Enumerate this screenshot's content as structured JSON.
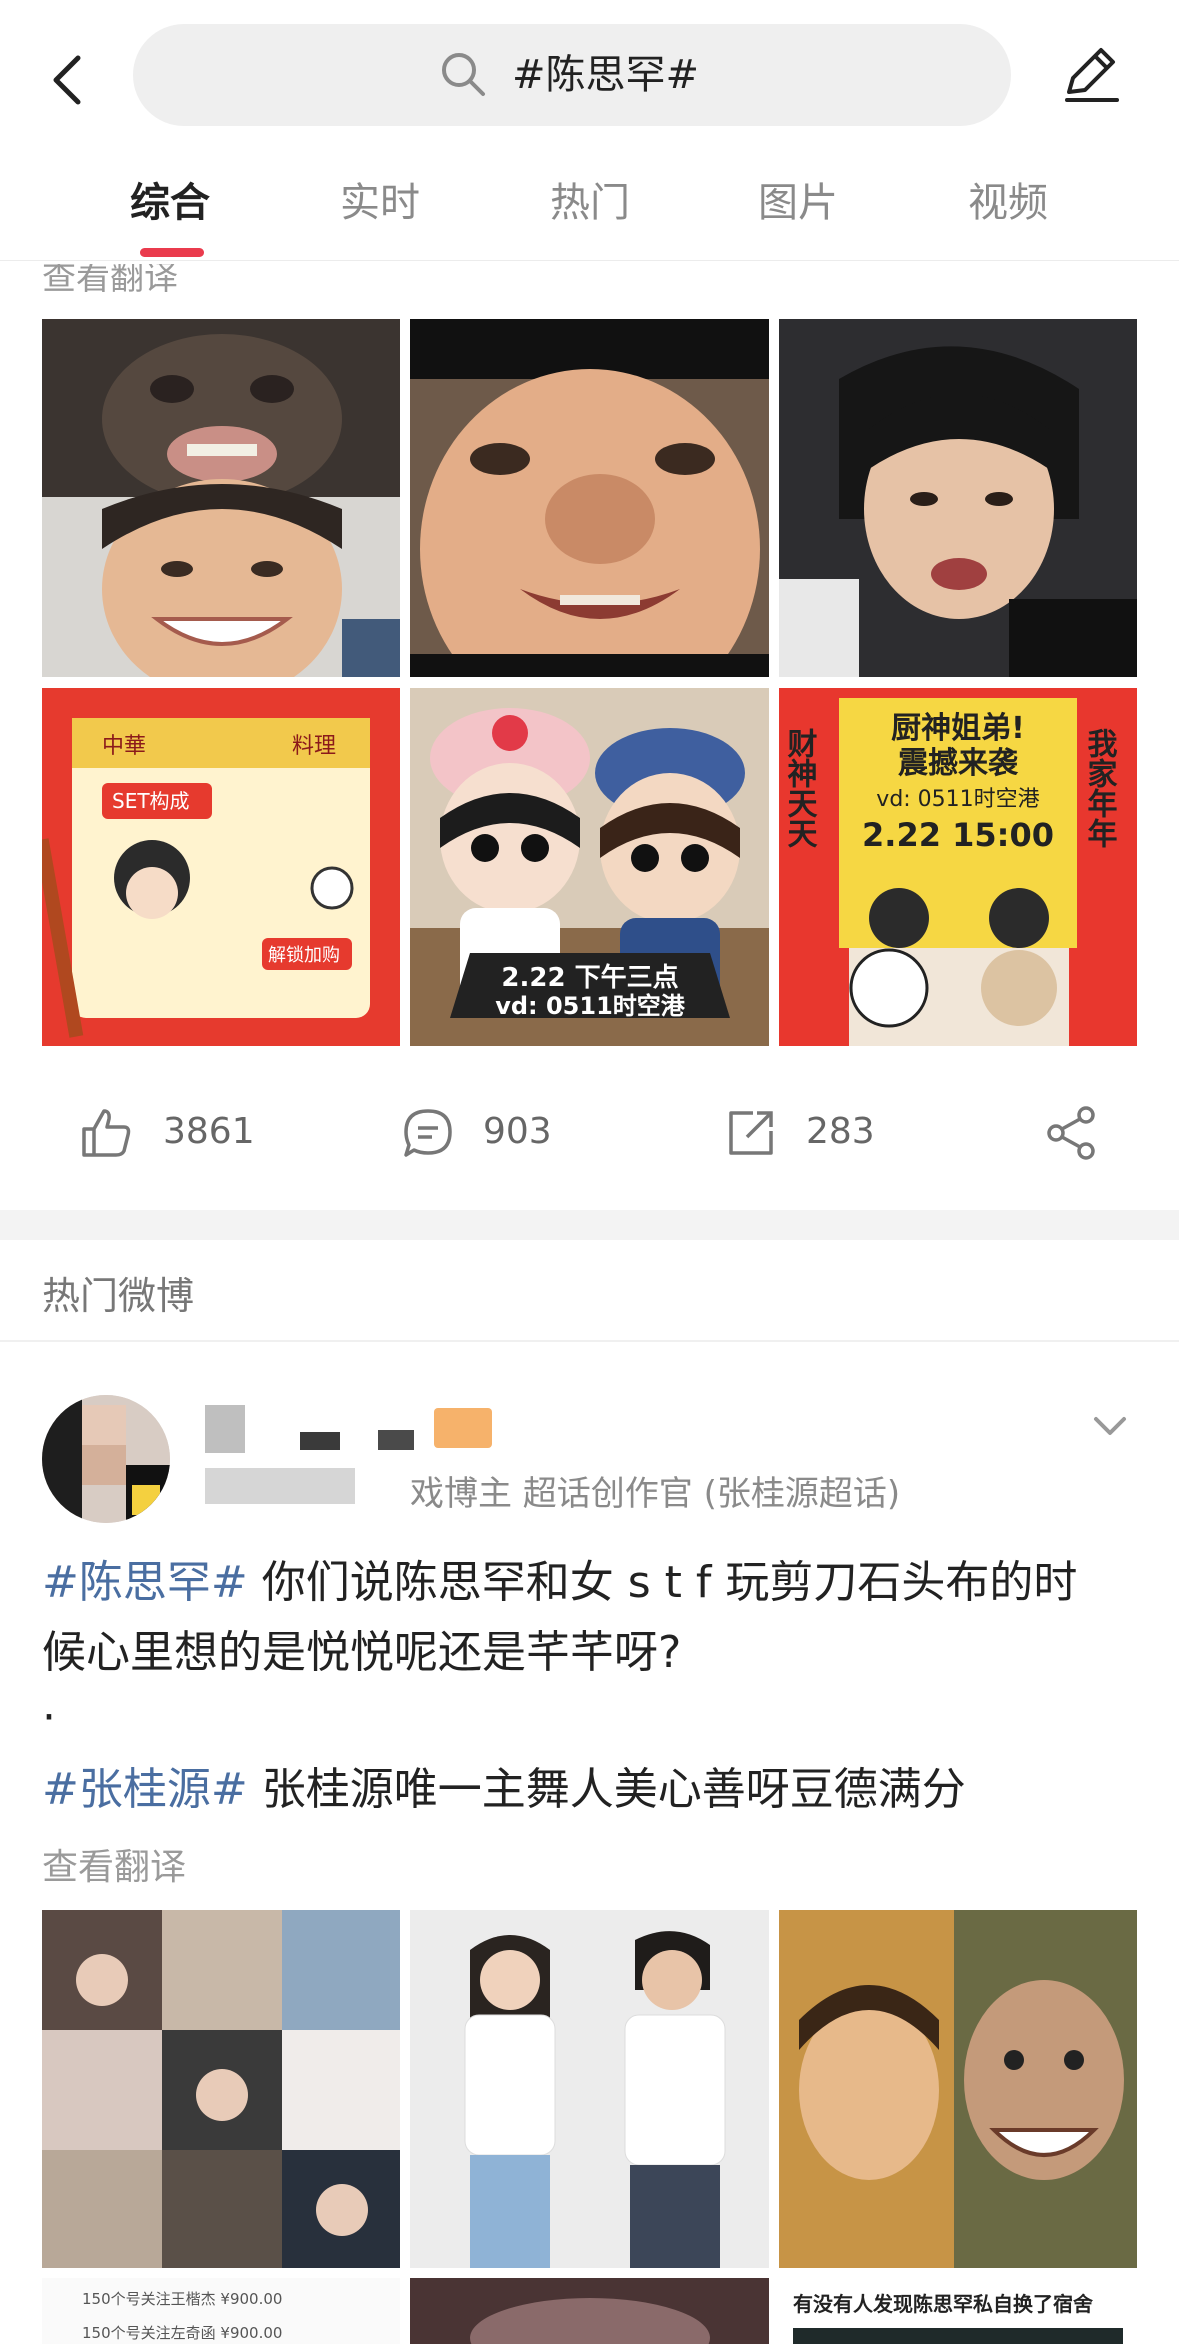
{
  "search": {
    "query": "#陈思罕#"
  },
  "tabs": [
    {
      "label": "综合",
      "active": true
    },
    {
      "label": "实时",
      "active": false
    },
    {
      "label": "热门",
      "active": false
    },
    {
      "label": "图片",
      "active": false
    },
    {
      "label": "视频",
      "active": false
    }
  ],
  "post1": {
    "translate_label": "查看翻译",
    "image_texts": {
      "img5_caption_1": "2.22 下午三点",
      "img5_caption_2": "vd: 0511时空港",
      "img6_title_1": "厨神姐弟!",
      "img6_title_2": "震撼来袭",
      "img6_sub": "vd: 0511时空港",
      "img6_time": "2.22 15:00",
      "img6_left_couplet": "财神天天",
      "img6_right_couplet": "我家年年",
      "img4_header_left": "中華",
      "img4_header_right": "料理",
      "img4_set": "SET构成",
      "img4_unlock": "解锁加购"
    },
    "actions": {
      "likes": "3861",
      "comments": "903",
      "reposts": "283"
    }
  },
  "hot_section": {
    "title": "热门微博"
  },
  "post2": {
    "meta": "戏博主 超话创作官 (张桂源超话)",
    "line1_tag": "#陈思罕#",
    "line1_text": " 你们说陈思罕和女 s t f 玩剪刀石头布的时",
    "line2_text": "候心里想的是悦悦呢还是芊芊呀?",
    "line3_text": "·",
    "line4_tag": "#张桂源#",
    "line4_text": " 张桂源唯一主舞人美心善呀豆德满分",
    "translate_label": "查看翻译",
    "bottom_texts": {
      "price_row_1": "150个号关注王楷杰 ¥900.00",
      "price_row_2": "150个号关注左奇函 ¥900.00",
      "caption_right": "有没有人发现陈思罕私自换了宿舍"
    }
  },
  "colors": {
    "accent": "#ea3b4d",
    "tag": "#4a6ea1",
    "muted": "#8a8a8a"
  }
}
